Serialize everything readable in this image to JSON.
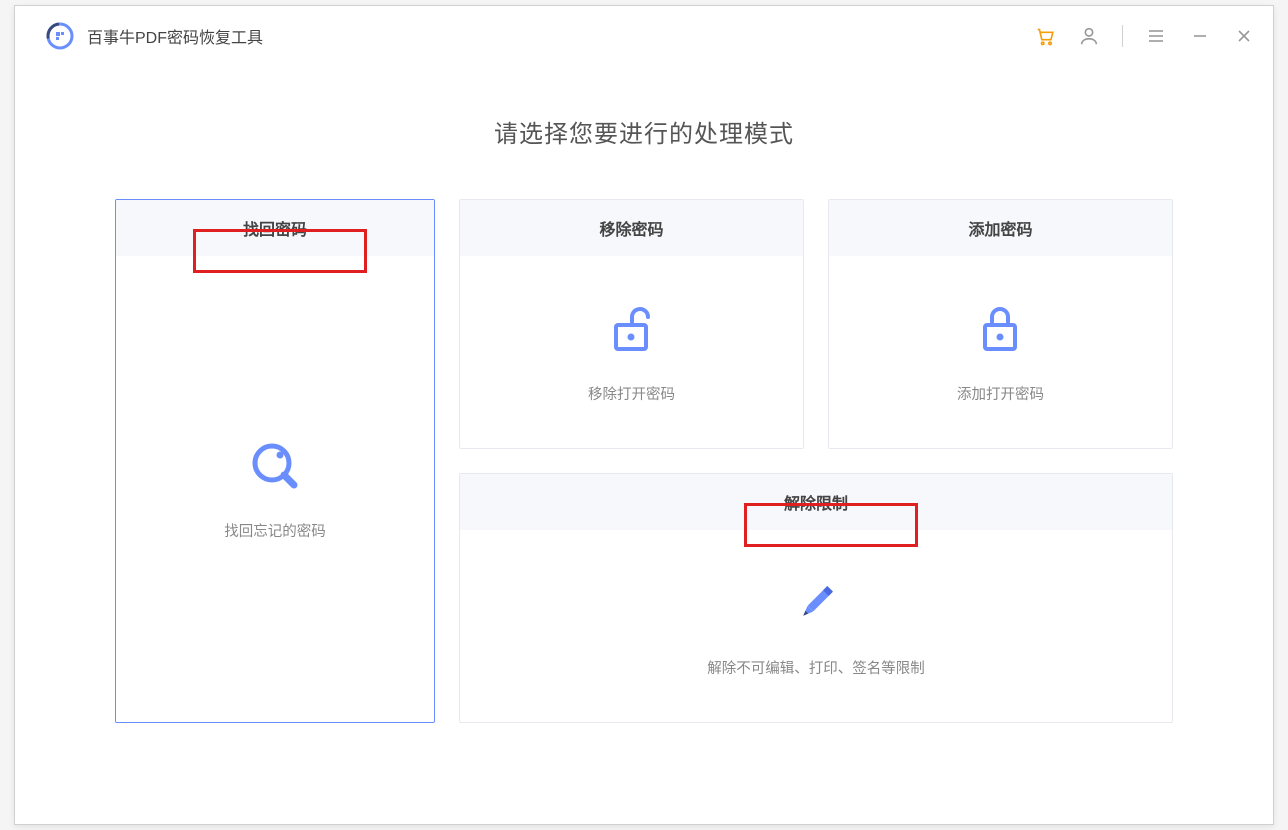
{
  "app": {
    "title": "百事牛PDF密码恢复工具"
  },
  "main": {
    "heading": "请选择您要进行的处理模式"
  },
  "cards": {
    "recover": {
      "title": "找回密码",
      "desc": "找回忘记的密码"
    },
    "remove": {
      "title": "移除密码",
      "desc": "移除打开密码"
    },
    "add": {
      "title": "添加密码",
      "desc": "添加打开密码"
    },
    "restriction": {
      "title": "解除限制",
      "desc": "解除不可编辑、打印、签名等限制"
    }
  },
  "colors": {
    "accent": "#6b8eff",
    "highlight": "#e02020",
    "cart": "#f59e0b"
  }
}
